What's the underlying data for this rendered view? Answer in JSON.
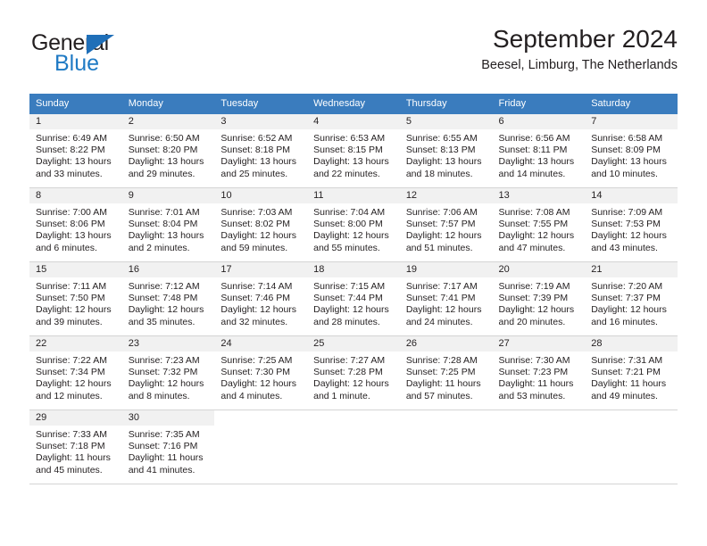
{
  "brand": {
    "name_top": "General",
    "name_bottom": "Blue",
    "triangle_color": "#1f6fb8",
    "blue_color": "#1f7ac4"
  },
  "header": {
    "title": "September 2024",
    "subtitle": "Beesel, Limburg, The Netherlands"
  },
  "theme": {
    "header_bg": "#3a7cbe",
    "daynum_bg": "#f1f1f1",
    "text": "#231f20",
    "row_border": "#d4d4d4"
  },
  "calendar": {
    "weekday_headers": [
      "Sunday",
      "Monday",
      "Tuesday",
      "Wednesday",
      "Thursday",
      "Friday",
      "Saturday"
    ],
    "weeks": [
      [
        {
          "day": "1",
          "sunrise": "Sunrise: 6:49 AM",
          "sunset": "Sunset: 8:22 PM",
          "daylight1": "Daylight: 13 hours",
          "daylight2": "and 33 minutes."
        },
        {
          "day": "2",
          "sunrise": "Sunrise: 6:50 AM",
          "sunset": "Sunset: 8:20 PM",
          "daylight1": "Daylight: 13 hours",
          "daylight2": "and 29 minutes."
        },
        {
          "day": "3",
          "sunrise": "Sunrise: 6:52 AM",
          "sunset": "Sunset: 8:18 PM",
          "daylight1": "Daylight: 13 hours",
          "daylight2": "and 25 minutes."
        },
        {
          "day": "4",
          "sunrise": "Sunrise: 6:53 AM",
          "sunset": "Sunset: 8:15 PM",
          "daylight1": "Daylight: 13 hours",
          "daylight2": "and 22 minutes."
        },
        {
          "day": "5",
          "sunrise": "Sunrise: 6:55 AM",
          "sunset": "Sunset: 8:13 PM",
          "daylight1": "Daylight: 13 hours",
          "daylight2": "and 18 minutes."
        },
        {
          "day": "6",
          "sunrise": "Sunrise: 6:56 AM",
          "sunset": "Sunset: 8:11 PM",
          "daylight1": "Daylight: 13 hours",
          "daylight2": "and 14 minutes."
        },
        {
          "day": "7",
          "sunrise": "Sunrise: 6:58 AM",
          "sunset": "Sunset: 8:09 PM",
          "daylight1": "Daylight: 13 hours",
          "daylight2": "and 10 minutes."
        }
      ],
      [
        {
          "day": "8",
          "sunrise": "Sunrise: 7:00 AM",
          "sunset": "Sunset: 8:06 PM",
          "daylight1": "Daylight: 13 hours",
          "daylight2": "and 6 minutes."
        },
        {
          "day": "9",
          "sunrise": "Sunrise: 7:01 AM",
          "sunset": "Sunset: 8:04 PM",
          "daylight1": "Daylight: 13 hours",
          "daylight2": "and 2 minutes."
        },
        {
          "day": "10",
          "sunrise": "Sunrise: 7:03 AM",
          "sunset": "Sunset: 8:02 PM",
          "daylight1": "Daylight: 12 hours",
          "daylight2": "and 59 minutes."
        },
        {
          "day": "11",
          "sunrise": "Sunrise: 7:04 AM",
          "sunset": "Sunset: 8:00 PM",
          "daylight1": "Daylight: 12 hours",
          "daylight2": "and 55 minutes."
        },
        {
          "day": "12",
          "sunrise": "Sunrise: 7:06 AM",
          "sunset": "Sunset: 7:57 PM",
          "daylight1": "Daylight: 12 hours",
          "daylight2": "and 51 minutes."
        },
        {
          "day": "13",
          "sunrise": "Sunrise: 7:08 AM",
          "sunset": "Sunset: 7:55 PM",
          "daylight1": "Daylight: 12 hours",
          "daylight2": "and 47 minutes."
        },
        {
          "day": "14",
          "sunrise": "Sunrise: 7:09 AM",
          "sunset": "Sunset: 7:53 PM",
          "daylight1": "Daylight: 12 hours",
          "daylight2": "and 43 minutes."
        }
      ],
      [
        {
          "day": "15",
          "sunrise": "Sunrise: 7:11 AM",
          "sunset": "Sunset: 7:50 PM",
          "daylight1": "Daylight: 12 hours",
          "daylight2": "and 39 minutes."
        },
        {
          "day": "16",
          "sunrise": "Sunrise: 7:12 AM",
          "sunset": "Sunset: 7:48 PM",
          "daylight1": "Daylight: 12 hours",
          "daylight2": "and 35 minutes."
        },
        {
          "day": "17",
          "sunrise": "Sunrise: 7:14 AM",
          "sunset": "Sunset: 7:46 PM",
          "daylight1": "Daylight: 12 hours",
          "daylight2": "and 32 minutes."
        },
        {
          "day": "18",
          "sunrise": "Sunrise: 7:15 AM",
          "sunset": "Sunset: 7:44 PM",
          "daylight1": "Daylight: 12 hours",
          "daylight2": "and 28 minutes."
        },
        {
          "day": "19",
          "sunrise": "Sunrise: 7:17 AM",
          "sunset": "Sunset: 7:41 PM",
          "daylight1": "Daylight: 12 hours",
          "daylight2": "and 24 minutes."
        },
        {
          "day": "20",
          "sunrise": "Sunrise: 7:19 AM",
          "sunset": "Sunset: 7:39 PM",
          "daylight1": "Daylight: 12 hours",
          "daylight2": "and 20 minutes."
        },
        {
          "day": "21",
          "sunrise": "Sunrise: 7:20 AM",
          "sunset": "Sunset: 7:37 PM",
          "daylight1": "Daylight: 12 hours",
          "daylight2": "and 16 minutes."
        }
      ],
      [
        {
          "day": "22",
          "sunrise": "Sunrise: 7:22 AM",
          "sunset": "Sunset: 7:34 PM",
          "daylight1": "Daylight: 12 hours",
          "daylight2": "and 12 minutes."
        },
        {
          "day": "23",
          "sunrise": "Sunrise: 7:23 AM",
          "sunset": "Sunset: 7:32 PM",
          "daylight1": "Daylight: 12 hours",
          "daylight2": "and 8 minutes."
        },
        {
          "day": "24",
          "sunrise": "Sunrise: 7:25 AM",
          "sunset": "Sunset: 7:30 PM",
          "daylight1": "Daylight: 12 hours",
          "daylight2": "and 4 minutes."
        },
        {
          "day": "25",
          "sunrise": "Sunrise: 7:27 AM",
          "sunset": "Sunset: 7:28 PM",
          "daylight1": "Daylight: 12 hours",
          "daylight2": "and 1 minute."
        },
        {
          "day": "26",
          "sunrise": "Sunrise: 7:28 AM",
          "sunset": "Sunset: 7:25 PM",
          "daylight1": "Daylight: 11 hours",
          "daylight2": "and 57 minutes."
        },
        {
          "day": "27",
          "sunrise": "Sunrise: 7:30 AM",
          "sunset": "Sunset: 7:23 PM",
          "daylight1": "Daylight: 11 hours",
          "daylight2": "and 53 minutes."
        },
        {
          "day": "28",
          "sunrise": "Sunrise: 7:31 AM",
          "sunset": "Sunset: 7:21 PM",
          "daylight1": "Daylight: 11 hours",
          "daylight2": "and 49 minutes."
        }
      ],
      [
        {
          "day": "29",
          "sunrise": "Sunrise: 7:33 AM",
          "sunset": "Sunset: 7:18 PM",
          "daylight1": "Daylight: 11 hours",
          "daylight2": "and 45 minutes."
        },
        {
          "day": "30",
          "sunrise": "Sunrise: 7:35 AM",
          "sunset": "Sunset: 7:16 PM",
          "daylight1": "Daylight: 11 hours",
          "daylight2": "and 41 minutes."
        },
        {
          "day": "",
          "sunrise": "",
          "sunset": "",
          "daylight1": "",
          "daylight2": ""
        },
        {
          "day": "",
          "sunrise": "",
          "sunset": "",
          "daylight1": "",
          "daylight2": ""
        },
        {
          "day": "",
          "sunrise": "",
          "sunset": "",
          "daylight1": "",
          "daylight2": ""
        },
        {
          "day": "",
          "sunrise": "",
          "sunset": "",
          "daylight1": "",
          "daylight2": ""
        },
        {
          "day": "",
          "sunrise": "",
          "sunset": "",
          "daylight1": "",
          "daylight2": ""
        }
      ]
    ]
  }
}
